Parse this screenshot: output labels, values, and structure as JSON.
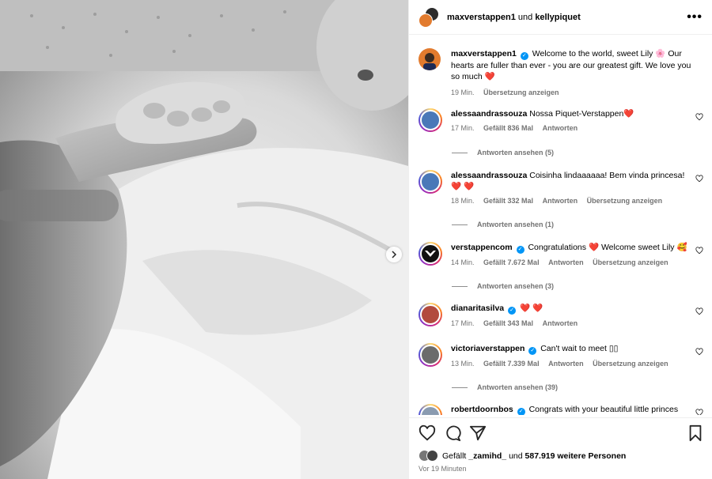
{
  "header": {
    "author1": "maxverstappen1",
    "connector": "und",
    "author2": "kellypiquet",
    "more": "•••"
  },
  "caption": {
    "username": "maxverstappen1",
    "text_1": "Welcome to the world, sweet Lily",
    "emoji_1": "🌸",
    "text_2": "Our hearts are fuller than ever - you are our greatest gift. We love you so much",
    "emoji_2": "❤️",
    "time": "19 Min.",
    "translate": "Übersetzung anzeigen"
  },
  "comments": [
    {
      "username": "alessaandrassouza",
      "text": "Nossa Piquet-Verstappen",
      "emoji": "❤️",
      "time": "17 Min.",
      "likes": "Gefällt 836 Mal",
      "reply": "Antworten",
      "translate": "",
      "view_replies": "Antworten ansehen (5)"
    },
    {
      "username": "alessaandrassouza",
      "text": "Coisinha lindaaaaaa! Bem vinda princesa!",
      "emoji": "❤️ ❤️",
      "time": "18 Min.",
      "likes": "Gefällt 332 Mal",
      "reply": "Antworten",
      "translate": "Übersetzung anzeigen",
      "view_replies": "Antworten ansehen (1)"
    },
    {
      "username": "verstappencom",
      "text": "Congratulations",
      "emoji": "❤️",
      "text_2": "Welcome sweet Lily",
      "emoji_2": "🥰",
      "time": "14 Min.",
      "likes": "Gefällt 7.672 Mal",
      "reply": "Antworten",
      "translate": "Übersetzung anzeigen",
      "view_replies": "Antworten ansehen (3)"
    },
    {
      "username": "dianaritasilva",
      "text": "",
      "emoji": "❤️ ❤️",
      "time": "17 Min.",
      "likes": "Gefällt 343 Mal",
      "reply": "Antworten",
      "translate": ""
    },
    {
      "username": "victoriaverstappen",
      "text": "Can't wait to meet",
      "emoji": "▯▯",
      "time": "13 Min.",
      "likes": "Gefällt 7.339 Mal",
      "reply": "Antworten",
      "translate": "Übersetzung anzeigen",
      "view_replies": "Antworten ansehen (39)"
    },
    {
      "username": "robertdoornbos",
      "text": "Congrats with your beautiful little princes"
    }
  ],
  "footer": {
    "liked_prefix": "Gefällt",
    "liked_user": "_zamihd_",
    "liked_and": "und",
    "liked_count": "587.919 weitere Personen",
    "time_ago": "Vor 19 Minuten"
  },
  "colors": {
    "verified": "#0095f6",
    "meta_gray": "#737373",
    "divider": "#efefef"
  }
}
